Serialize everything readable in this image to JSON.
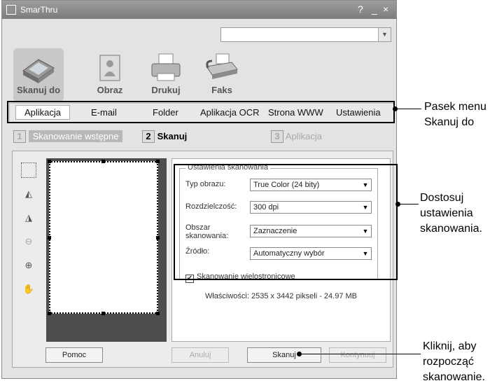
{
  "window": {
    "title": "SmarThru"
  },
  "titlebar_controls": {
    "help": "?",
    "minimize": "_",
    "close": "×"
  },
  "nav": [
    {
      "label": "Skanuj do",
      "icon": "scanner-icon"
    },
    {
      "label": "Obraz",
      "icon": "image-icon"
    },
    {
      "label": "Drukuj",
      "icon": "printer-icon"
    },
    {
      "label": "Faks",
      "icon": "fax-icon"
    }
  ],
  "menu": {
    "items": [
      "Aplikacja",
      "E-mail",
      "Folder",
      "Aplikacja OCR",
      "Strona WWW",
      "Ustawienia"
    ],
    "selected": "Aplikacja"
  },
  "steps": [
    {
      "num": "1",
      "label": "Skanowanie wstępne"
    },
    {
      "num": "2",
      "label": "Skanuj"
    },
    {
      "num": "3",
      "label": "Aplikacja"
    }
  ],
  "tools": [
    "select-area-icon",
    "flip-horizontal-icon",
    "rotate-icon",
    "zoom-out-icon",
    "zoom-in-icon",
    "hand-icon"
  ],
  "settings": {
    "legend": "Ustawienia skanowania",
    "image_type_label": "Typ obrazu:",
    "image_type_value": "True Color (24 bity)",
    "resolution_label": "Rozdzielczość:",
    "resolution_value": "300 dpi",
    "area_label_1": "Obszar",
    "area_label_2": "skanowania:",
    "area_value": "Zaznaczenie",
    "source_label": "Źródło:",
    "source_value": "Automatyczny wybór",
    "multipage_label": "Skanowanie wielostronicowe",
    "multipage_checked": true
  },
  "properties": "Właściwości: 2535 x 3442 pikseli - 24.97 MB",
  "buttons": {
    "help": "Pomoc",
    "cancel": "Anuluj",
    "scan": "Skanuj",
    "continue": "Kontynuuj"
  },
  "callouts": {
    "menu_1": "Pasek menu",
    "menu_2": "Skanuj do",
    "settings_1": "Dostosuj",
    "settings_2": "ustawienia",
    "settings_3": "skanowania.",
    "scan_1": "Kliknij, aby",
    "scan_2": "rozpocząć",
    "scan_3": "skanowanie."
  }
}
